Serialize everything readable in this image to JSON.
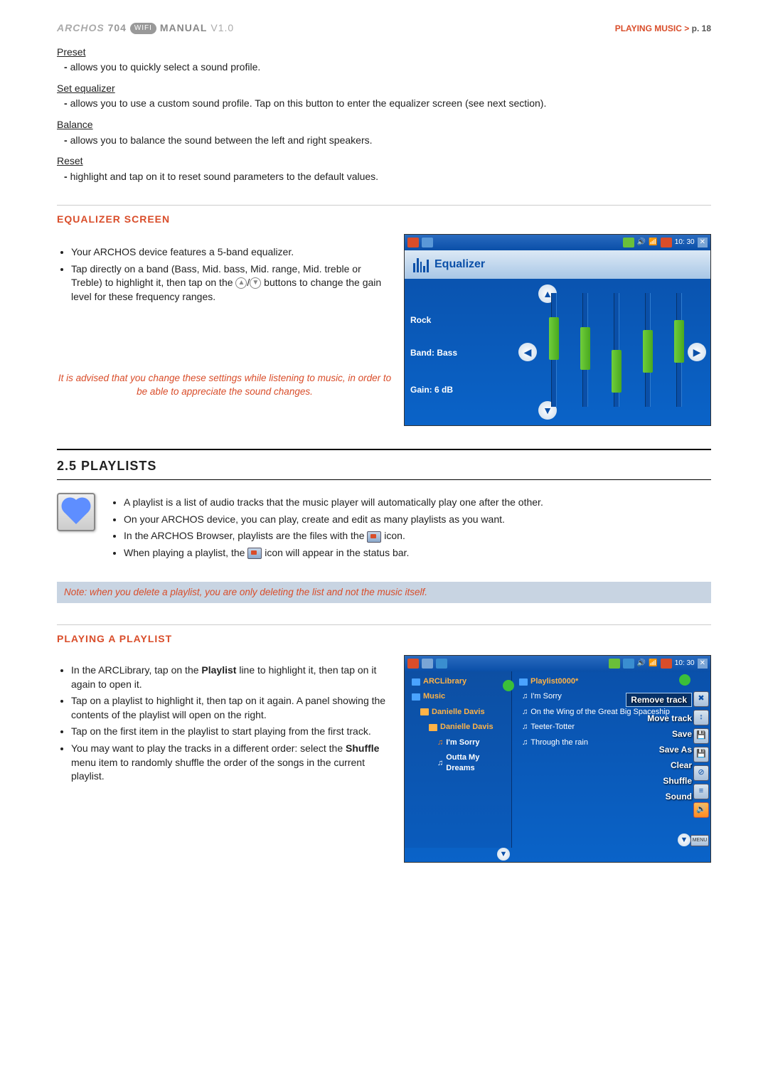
{
  "header": {
    "brand": "ARCHOS",
    "model": "704",
    "wifi_badge": "WIFI",
    "manual": "MANUAL",
    "version": "V1.0",
    "section": "PLAYING MUSIC",
    "arrow": ">",
    "page_label": "p. 18"
  },
  "settings": [
    {
      "name": "Preset",
      "desc": "allows you to quickly select a sound profile."
    },
    {
      "name": "Set equalizer",
      "desc": "allows you to use a custom sound profile. Tap on this button to enter the equalizer screen (see next section)."
    },
    {
      "name": "Balance",
      "desc": "allows you to balance the sound between the left and right speakers."
    },
    {
      "name": "Reset",
      "desc": "highlight and tap on it to reset sound parameters to the default values."
    }
  ],
  "eq": {
    "heading": "EQUALIZER SCREEN",
    "bullets": [
      "Your ARCHOS device features a 5-band equalizer.",
      "Tap directly on a band (Bass, Mid. bass, Mid. range, Mid. treble or Treble) to highlight it, then tap on the ⃝/⃝ buttons to change the gain level for these frequency ranges."
    ],
    "advice": "It is advised that you change these settings while listening to music, in order to be able to appreciate the sound changes.",
    "shot": {
      "title": "Equalizer",
      "preset": "Rock",
      "band_label": "Band: Bass",
      "gain_label": "Gain: 6 dB",
      "time": "10: 30"
    }
  },
  "section25": {
    "title": "2.5   PLAYLISTS",
    "bullets": [
      "A playlist is a list of audio tracks that the music player will automatically play one after the other.",
      "On your ARCHOS device, you can play, create and edit as many playlists as you want.",
      "In the ARCHOS Browser, playlists are the files with the  icon.",
      "When playing a playlist, the  icon will appear in the status bar."
    ],
    "note": "Note: when you delete a playlist, you are only deleting the list and not the music itself."
  },
  "playing": {
    "heading": "PLAYING A PLAYLIST",
    "bullets_html": [
      "In the ARCLibrary, tap on the <b>Playlist</b> line to highlight it, then tap on it again to open it.",
      "Tap on a playlist to highlight it, then tap on it again. A panel showing the contents of the playlist will open on the right.",
      "Tap on the first item in the playlist to start playing from the first track.",
      "You may want to play the tracks in a different order: select the <b>Shuffle</b> menu item to randomly shuffle the order of the songs in the current playlist."
    ],
    "shot": {
      "time": "10: 30",
      "left_tree": {
        "root": "ARCLibrary",
        "rows": [
          "Music",
          "Danielle Davis",
          "Danielle Davis",
          "I'm Sorry",
          "Outta My Dreams"
        ]
      },
      "right_head": "Playlist0000*",
      "tracks": [
        "I'm Sorry",
        "On the Wing of the Great Big Spaceship",
        "Teeter-Totter",
        "Through the rain"
      ],
      "ctx_menu": [
        "Remove track",
        "Move track",
        "Save",
        "Save As",
        "Clear",
        "Shuffle",
        "Sound"
      ],
      "menu_label": "MENU"
    }
  }
}
